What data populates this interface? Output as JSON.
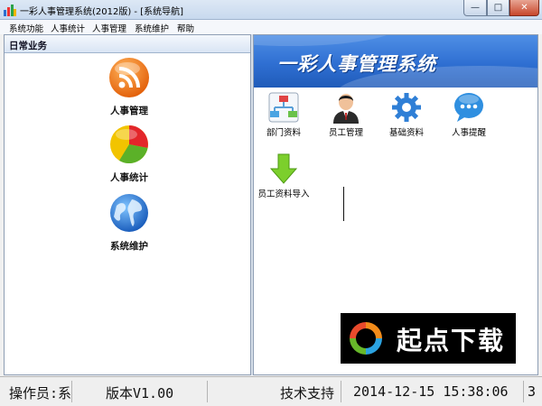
{
  "window": {
    "title": "一彩人事管理系统(2012版) - [系统导航]",
    "min_glyph": "—",
    "max_glyph": "□",
    "close_glyph": "✕"
  },
  "menu": [
    "系统功能",
    "人事统计",
    "人事管理",
    "系统维护",
    "帮助"
  ],
  "left_panel": {
    "header": "日常业务",
    "items": [
      {
        "label": "人事管理",
        "icon": "rss-icon"
      },
      {
        "label": "人事统计",
        "icon": "pie-chart-icon"
      },
      {
        "label": "系统维护",
        "icon": "globe-icon"
      }
    ]
  },
  "right_panel": {
    "banner_title": "一彩人事管理系统",
    "tools": [
      {
        "label": "部门资料",
        "icon": "org-chart-icon"
      },
      {
        "label": "员工管理",
        "icon": "employee-icon"
      },
      {
        "label": "基础资料",
        "icon": "gear-icon"
      },
      {
        "label": "人事提醒",
        "icon": "chat-bubble-icon"
      },
      {
        "label": "员工资料导入",
        "icon": "download-arrow-icon"
      }
    ]
  },
  "watermark": {
    "text": "起点下载"
  },
  "status": {
    "operator": "操作员:系",
    "version": "版本V1.00",
    "support": "技术支持",
    "datetime": "2014-12-15 15:38:06",
    "extra": "3"
  },
  "colors": {
    "banner": "#2f6fd2",
    "accent": "#4f8fe5"
  }
}
